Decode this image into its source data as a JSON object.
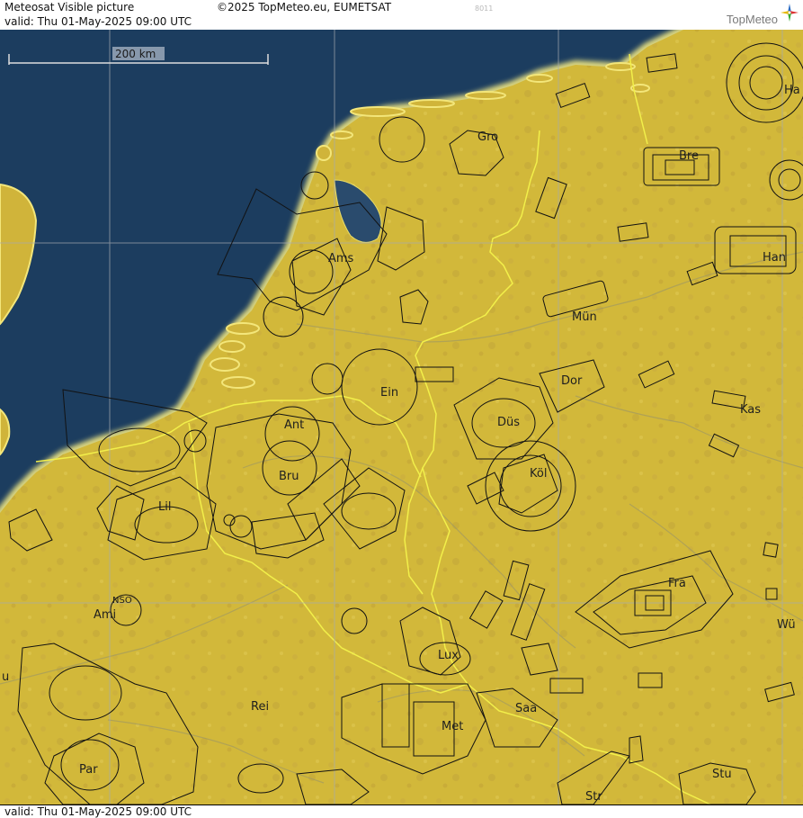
{
  "header": {
    "title": "Meteosat Visible picture",
    "copyright": "©2025 TopMeteo.eu, EUMETSAT",
    "code": "8011",
    "valid": "valid:  Thu  01-May-2025  09:00 UTC",
    "logo": "TopMeteo"
  },
  "footer": {
    "valid": "valid:  Thu  01-May-2025  09:00 UTC"
  },
  "scale": {
    "label": "200 km"
  },
  "cities": {
    "gro": "Gro",
    "bre": "Bre",
    "ha": "Ha",
    "ams": "Ams",
    "han": "Han",
    "mun": "Mün",
    "ein": "Ein",
    "dor": "Dor",
    "ant": "Ant",
    "dus": "Düs",
    "kas": "Kas",
    "bru": "Bru",
    "kol": "Köl",
    "lil": "Lil",
    "nso": "NSO",
    "ami": "Ami",
    "fra": "Fra",
    "wu": "Wü",
    "lux": "Lux",
    "u": "u",
    "rei": "Rei",
    "saa": "Saa",
    "met": "Met",
    "par": "Par",
    "stu": "Stu",
    "str": "Str"
  },
  "colors": {
    "sea": "#1d3c5e",
    "land": "#d4bd3c",
    "coast_glow": "#f3e67a",
    "border": "#f1ee3e",
    "grid": "#9aa0aa",
    "airspace": "#111111"
  }
}
